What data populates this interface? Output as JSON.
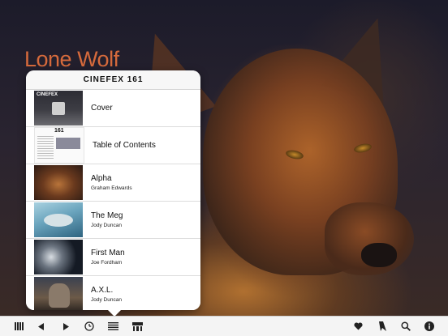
{
  "background": {
    "title": "Lone Wolf",
    "title_color": "#d56a3c"
  },
  "popover": {
    "title": "CINEFEX  161",
    "items": [
      {
        "title": "Cover",
        "subtitle": "",
        "thumb": "cover",
        "thumb_label": "CINEFEX"
      },
      {
        "title": "Table of Contents",
        "subtitle": "",
        "thumb": "toc",
        "thumb_label": "161"
      },
      {
        "title": "Alpha",
        "subtitle": "Graham Edwards",
        "thumb": "alpha"
      },
      {
        "title": "The Meg",
        "subtitle": "Jody Duncan",
        "thumb": "meg"
      },
      {
        "title": "First Man",
        "subtitle": "Joe Fordham",
        "thumb": "firstman"
      },
      {
        "title": "A.X.L.",
        "subtitle": "Jody Duncan",
        "thumb": "axl"
      }
    ]
  },
  "toolbar": {
    "left": [
      "grid-icon",
      "back-arrow-icon",
      "forward-arrow-icon",
      "history-clock-icon",
      "contents-list-icon",
      "page-thumbnails-icon"
    ],
    "right": [
      "favorite-heart-icon",
      "bookmark-icon",
      "search-icon",
      "info-icon"
    ]
  }
}
